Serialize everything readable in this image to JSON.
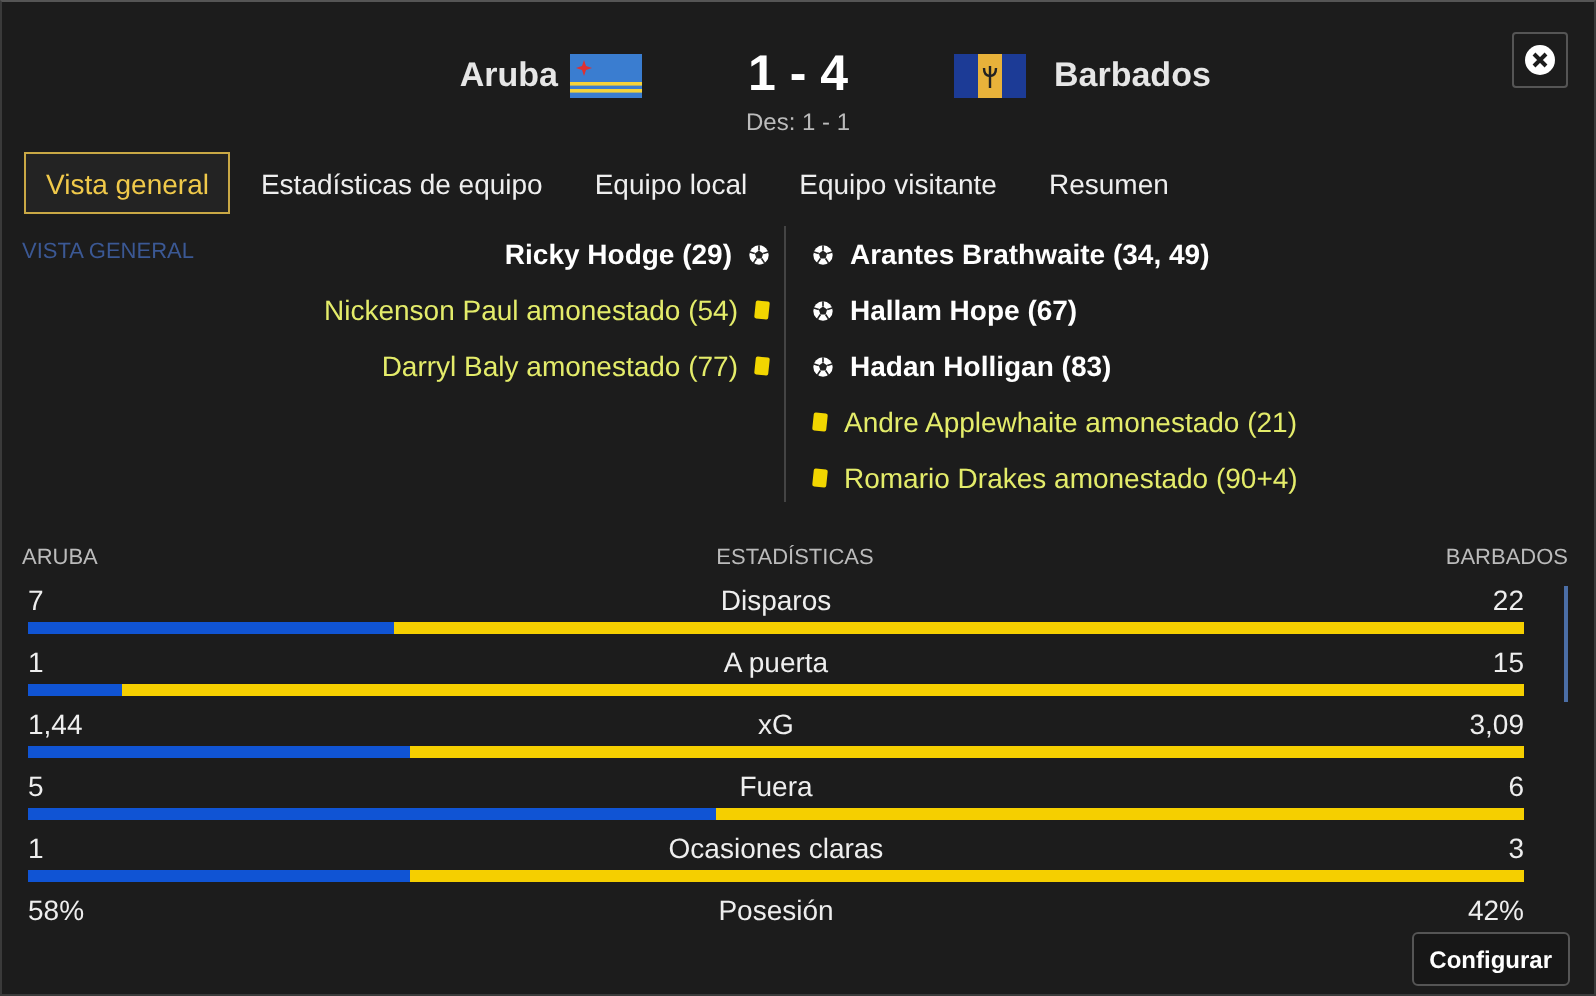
{
  "home": {
    "name": "Aruba"
  },
  "away": {
    "name": "Barbados"
  },
  "score": "1 - 4",
  "halftime": "Des: 1 - 1",
  "tabs": [
    {
      "label": "Vista general",
      "selected": true
    },
    {
      "label": "Estadísticas de equipo",
      "selected": false
    },
    {
      "label": "Equipo local",
      "selected": false
    },
    {
      "label": "Equipo visitante",
      "selected": false
    },
    {
      "label": "Resumen",
      "selected": false
    }
  ],
  "section_label": "VISTA GENERAL",
  "home_events": [
    {
      "kind": "goal",
      "text": "Ricky Hodge (29)"
    },
    {
      "kind": "yellow",
      "text": "Nickenson Paul amonestado (54)"
    },
    {
      "kind": "yellow",
      "text": "Darryl Baly amonestado (77)"
    }
  ],
  "away_events": [
    {
      "kind": "goal",
      "text": "Arantes Brathwaite (34, 49)"
    },
    {
      "kind": "goal",
      "text": "Hallam Hope (67)"
    },
    {
      "kind": "goal",
      "text": "Hadan Holligan (83)"
    },
    {
      "kind": "yellow",
      "text": "Andre Applewhaite amonestado (21)"
    },
    {
      "kind": "yellow",
      "text": "Romario Drakes amonestado (90+4)"
    }
  ],
  "stats_header": {
    "home": "ARUBA",
    "title": "ESTADÍSTICAS",
    "away": "BARBADOS"
  },
  "stats": [
    {
      "label": "Disparos",
      "home": "7",
      "away": "22",
      "kind": "bar",
      "level": 0.245
    },
    {
      "label": "A puerta",
      "home": "1",
      "away": "15",
      "kind": "bar",
      "level": 0.063
    },
    {
      "label": "xG",
      "home": "1,44",
      "away": "3,09",
      "kind": "bar",
      "level": 0.255
    },
    {
      "label": "Fuera",
      "home": "5",
      "away": "6",
      "kind": "bar",
      "level": 0.46
    },
    {
      "label": "Ocasiones claras",
      "home": "1",
      "away": "3",
      "kind": "bar",
      "level": 0.255
    },
    {
      "label": "Posesión",
      "home": "58%",
      "away": "42%",
      "kind": "plain"
    }
  ],
  "configure_button": "Configurar"
}
